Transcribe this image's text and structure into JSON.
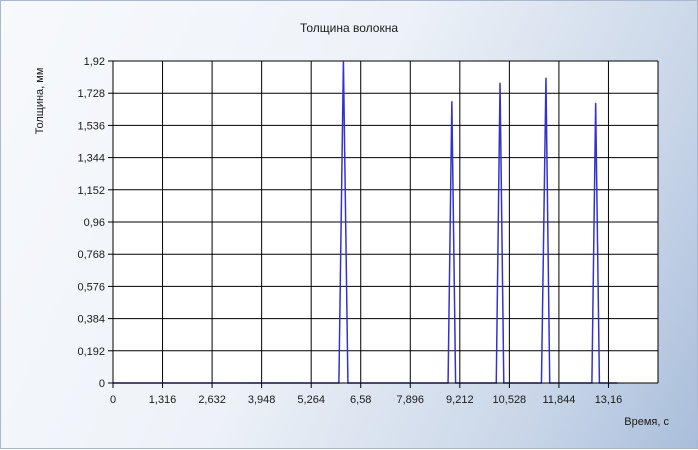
{
  "chart_data": {
    "type": "line",
    "title": "Толщина волокна",
    "xlabel": "Время, с",
    "ylabel": "Толщина, мм",
    "xlim": [
      0,
      14.476
    ],
    "ylim": [
      0,
      1.92
    ],
    "x_ticks": [
      "0",
      "1,316",
      "2,632",
      "3,948",
      "5,264",
      "6,58",
      "7,896",
      "9,212",
      "10,528",
      "11,844",
      "13,16"
    ],
    "y_ticks": [
      "0",
      "0,192",
      "0,384",
      "0,576",
      "0,768",
      "0,96",
      "1,152",
      "1,344",
      "1,536",
      "1,728",
      "1,92"
    ],
    "grid": true,
    "series": [
      {
        "color": "#3333cc",
        "x": [
          0,
          6.0,
          6.12,
          6.24,
          8.9,
          9.0,
          9.1,
          10.18,
          10.28,
          10.38,
          11.38,
          11.5,
          11.6,
          12.72,
          12.82,
          12.92,
          13.4
        ],
        "y": [
          0,
          0,
          1.92,
          0,
          0,
          1.68,
          0,
          0,
          1.79,
          0,
          0,
          1.82,
          0,
          0,
          1.67,
          0,
          0
        ]
      }
    ]
  }
}
